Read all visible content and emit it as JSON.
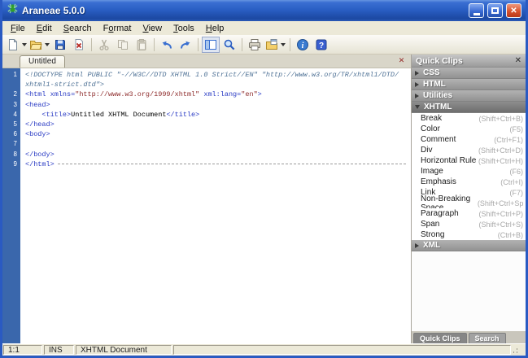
{
  "window": {
    "title": "Araneae 5.0.0"
  },
  "menu": {
    "items": [
      {
        "label": "File",
        "underline": 0
      },
      {
        "label": "Edit",
        "underline": 0
      },
      {
        "label": "Search",
        "underline": 0
      },
      {
        "label": "Format",
        "underline": 1
      },
      {
        "label": "View",
        "underline": 0
      },
      {
        "label": "Tools",
        "underline": 0
      },
      {
        "label": "Help",
        "underline": 0
      }
    ]
  },
  "toolbar": {
    "buttons": [
      {
        "icon": "new-document",
        "dropdown": true
      },
      {
        "icon": "open-file",
        "dropdown": true
      },
      {
        "icon": "save"
      },
      {
        "icon": "close-document"
      },
      {
        "sep": true
      },
      {
        "icon": "cut",
        "disabled": true
      },
      {
        "icon": "copy",
        "disabled": true
      },
      {
        "icon": "paste",
        "disabled": true
      },
      {
        "sep": true
      },
      {
        "icon": "undo"
      },
      {
        "icon": "redo"
      },
      {
        "sep": true
      },
      {
        "icon": "toggle-panel",
        "pressed": true
      },
      {
        "icon": "search"
      },
      {
        "sep": true
      },
      {
        "icon": "print"
      },
      {
        "icon": "preview-browser",
        "dropdown": true
      },
      {
        "sep": true
      },
      {
        "icon": "info"
      },
      {
        "icon": "help"
      }
    ]
  },
  "tab_bar": {
    "tabs": [
      {
        "label": "Untitled",
        "active": true
      }
    ]
  },
  "editor": {
    "lines": [
      {
        "num": "1",
        "segments": [
          {
            "t": "<!DOCTYPE html PUBLIC \"-//W3C//DTD XHTML 1.0 Strict//EN\" \"http://www.w3.org/TR/xhtml1/DTD/",
            "c": "doctype"
          }
        ]
      },
      {
        "num": "",
        "segments": [
          {
            "t": "xhtml1-strict.dtd\">",
            "c": "doctype"
          }
        ]
      },
      {
        "num": "2",
        "segments": [
          {
            "t": "<html xmlns=",
            "c": "tag"
          },
          {
            "t": "\"http://www.w3.org/1999/xhtml\"",
            "c": "value"
          },
          {
            "t": " xml:lang=",
            "c": "tag"
          },
          {
            "t": "\"en\"",
            "c": "value"
          },
          {
            "t": ">",
            "c": "tag"
          }
        ]
      },
      {
        "num": "3",
        "segments": [
          {
            "t": "<head>",
            "c": "tag"
          }
        ]
      },
      {
        "num": "4",
        "segments": [
          {
            "t": "    ",
            "c": "text"
          },
          {
            "t": "<title>",
            "c": "tag"
          },
          {
            "t": "Untitled XHTML Document",
            "c": "text"
          },
          {
            "t": "</title>",
            "c": "tag"
          }
        ]
      },
      {
        "num": "5",
        "segments": [
          {
            "t": "</head>",
            "c": "tag"
          }
        ]
      },
      {
        "num": "6",
        "segments": [
          {
            "t": "<body>",
            "c": "tag"
          }
        ]
      },
      {
        "num": "7",
        "segments": []
      },
      {
        "num": "8",
        "segments": [
          {
            "t": "</body>",
            "c": "tag"
          }
        ]
      },
      {
        "num": "9",
        "segments": [
          {
            "t": "</html>",
            "c": "tag"
          }
        ],
        "trailing_rule": true
      }
    ]
  },
  "quick_clips": {
    "title": "Quick Clips",
    "sections": [
      {
        "label": "CSS",
        "expanded": false,
        "items": []
      },
      {
        "label": "HTML",
        "expanded": false,
        "items": []
      },
      {
        "label": "Utilities",
        "expanded": false,
        "items": []
      },
      {
        "label": "XHTML",
        "expanded": true,
        "items": [
          {
            "label": "Break",
            "shortcut": "(Shift+Ctrl+B)"
          },
          {
            "label": "Color",
            "shortcut": "(F5)"
          },
          {
            "label": "Comment",
            "shortcut": "(Ctrl+F1)"
          },
          {
            "label": "Div",
            "shortcut": "(Shift+Ctrl+D)"
          },
          {
            "label": "Horizontal Rule",
            "shortcut": "(Shift+Ctrl+H)"
          },
          {
            "label": "Image",
            "shortcut": "(F6)"
          },
          {
            "label": "Emphasis",
            "shortcut": "(Ctrl+I)"
          },
          {
            "label": "Link",
            "shortcut": "(F7)"
          },
          {
            "label": "Non-Breaking Space",
            "shortcut": "(Shift+Ctrl+Space)"
          },
          {
            "label": "Paragraph",
            "shortcut": "(Shift+Ctrl+P)"
          },
          {
            "label": "Span",
            "shortcut": "(Shift+Ctrl+S)"
          },
          {
            "label": "Strong",
            "shortcut": "(Ctrl+B)"
          }
        ]
      },
      {
        "label": "XML",
        "expanded": false,
        "items": []
      }
    ],
    "bottom_tabs": [
      {
        "label": "Quick Clips",
        "active": true
      },
      {
        "label": "Search",
        "active": false
      }
    ]
  },
  "status_bar": {
    "cursor": "1:1",
    "mode": "INS",
    "document_type": "XHTML Document"
  }
}
